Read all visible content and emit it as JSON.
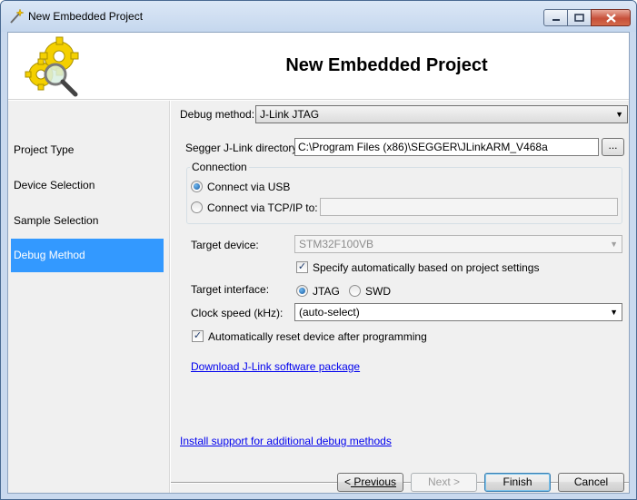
{
  "window": {
    "title": "New Embedded Project",
    "header_title": "New Embedded Project",
    "wizard_icon": "gears-magnifier-icon"
  },
  "sidebar": {
    "items": [
      {
        "label": "Project Type",
        "active": false
      },
      {
        "label": "Device Selection",
        "active": false
      },
      {
        "label": "Sample Selection",
        "active": false
      },
      {
        "label": "Debug Method",
        "active": true
      }
    ],
    "active_color": "#3399ff"
  },
  "debug_method": {
    "label": "Debug method:",
    "value": "J-Link JTAG"
  },
  "jlink_directory": {
    "label": "Segger J-Link directory:",
    "value": "C:\\Program Files (x86)\\SEGGER\\JLinkARM_V468a",
    "browse_label": "..."
  },
  "connection": {
    "title": "Connection",
    "usb_label": "Connect via USB",
    "usb_selected": true,
    "tcp_label": "Connect via TCP/IP to:",
    "tcp_selected": false,
    "tcp_value": ""
  },
  "target_device": {
    "label": "Target device:",
    "value": "STM32F100VB",
    "auto_checkbox_label": "Specify automatically based on project settings",
    "auto_checked": true
  },
  "target_interface": {
    "label": "Target interface:",
    "options": [
      "JTAG",
      "SWD"
    ],
    "selected": "JTAG"
  },
  "clock_speed": {
    "label": "Clock speed (kHz):",
    "value": "(auto-select)"
  },
  "reset_device": {
    "label": "Automatically reset device after programming",
    "checked": true
  },
  "links": {
    "download": "Download J-Link software package",
    "install_support": "Install support for additional debug methods"
  },
  "buttons": {
    "previous_mnemonic": "<",
    "previous_rest": " Previous",
    "next": "Next >",
    "finish": "Finish",
    "cancel": "Cancel"
  },
  "colors": {
    "link": "#0000ee",
    "selection": "#3399ff"
  }
}
